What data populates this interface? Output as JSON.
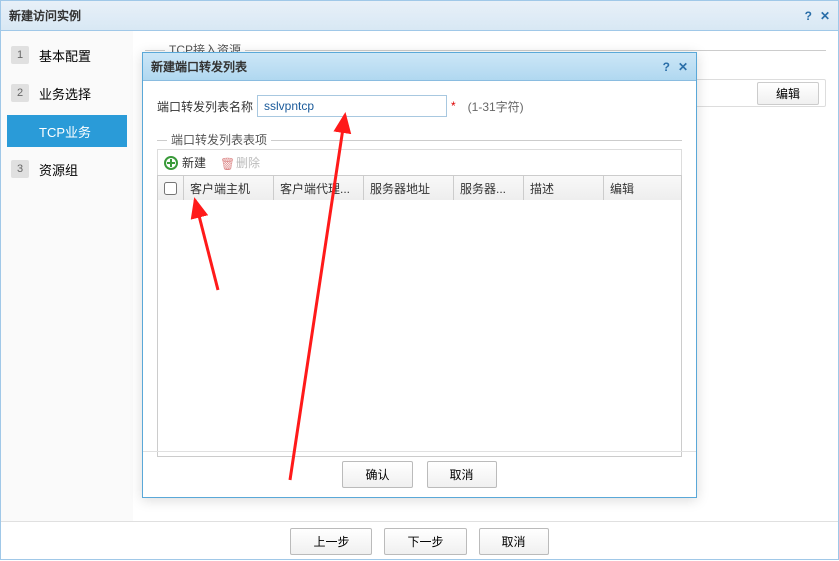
{
  "main_window": {
    "title": "新建访问实例",
    "help": "?",
    "close": "✕"
  },
  "sidebar": {
    "steps": [
      {
        "num": "1",
        "label": "基本配置"
      },
      {
        "num": "2",
        "label": "业务选择"
      },
      {
        "num": "",
        "label": "TCP业务"
      },
      {
        "num": "3",
        "label": "资源组"
      }
    ]
  },
  "content": {
    "fieldset_label": "TCP接入资源",
    "edit_button": "编辑"
  },
  "footer": {
    "prev": "上一步",
    "next": "下一步",
    "cancel": "取消"
  },
  "modal": {
    "title": "新建端口转发列表",
    "help": "?",
    "close": "✕",
    "name_label": "端口转发列表名称",
    "name_value": "sslvpntcp",
    "name_hint": "(1-31字符)",
    "sub_fieldset": "端口转发列表表项",
    "toolbar": {
      "new": "新建",
      "delete": "删除"
    },
    "columns": {
      "c1": "客户端主机",
      "c2": "客户端代理...",
      "c3": "服务器地址",
      "c4": "服务器...",
      "c5": "描述",
      "c6": "编辑"
    },
    "ok": "确认",
    "cancel": "取消"
  }
}
